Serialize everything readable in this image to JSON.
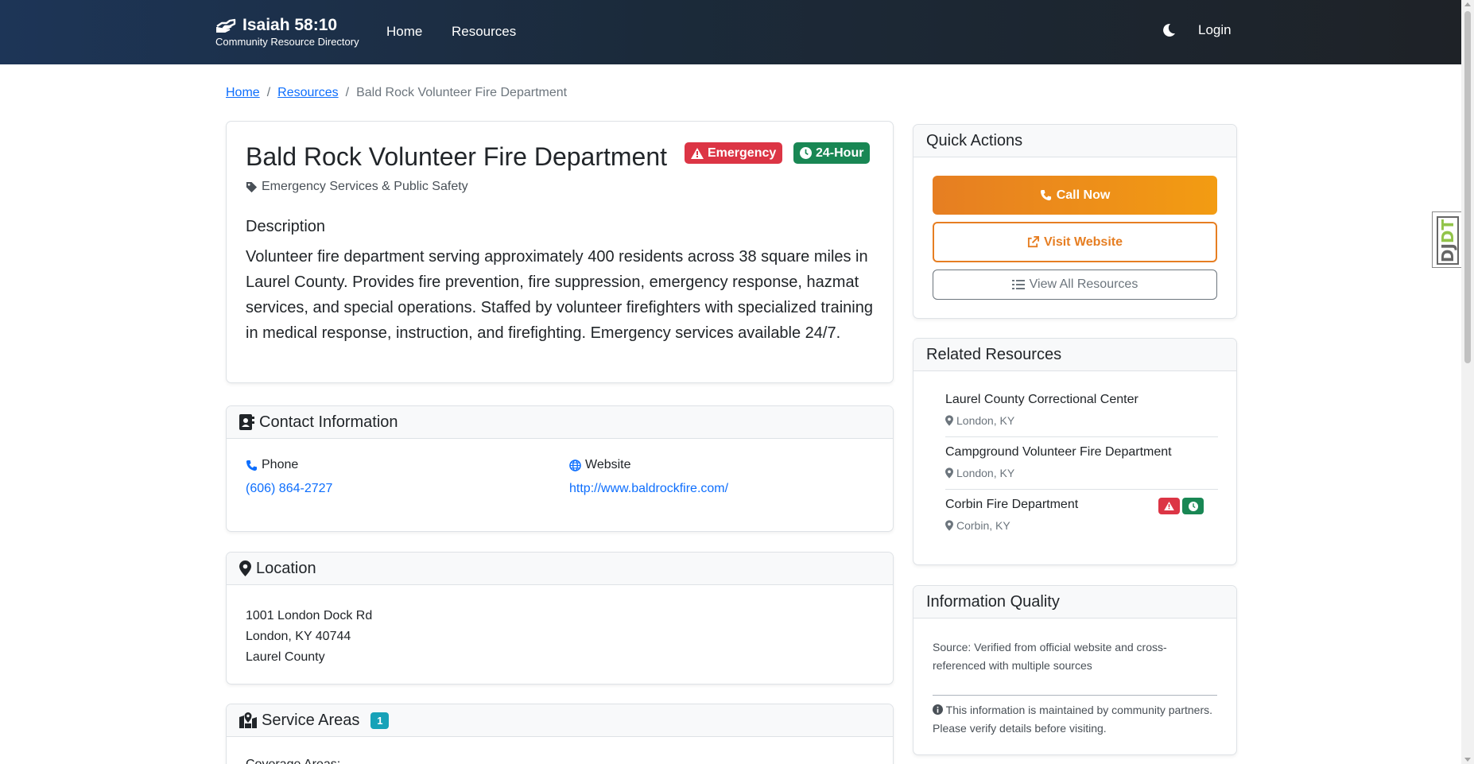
{
  "nav": {
    "brand_title": "Isaiah 58:10",
    "brand_sub": "Community Resource Directory",
    "links": [
      "Home",
      "Resources"
    ],
    "login": "Login"
  },
  "breadcrumb": {
    "home": "Home",
    "resources": "Resources",
    "current": "Bald Rock Volunteer Fire Department"
  },
  "resource": {
    "title": "Bald Rock Volunteer Fire Department",
    "badge_emergency": "Emergency",
    "badge_24hour": "24-Hour",
    "category": "Emergency Services & Public Safety",
    "description_heading": "Description",
    "description": "Volunteer fire department serving approximately 400 residents across 38 square miles in Laurel County. Provides fire prevention, fire suppression, emergency response, hazmat services, and special operations. Staffed by volunteer firefighters with specialized training in medical response, instruction, and firefighting. Emergency services available 24/7."
  },
  "contact": {
    "heading": "Contact Information",
    "phone_label": "Phone",
    "phone": "(606) 864-2727",
    "website_label": "Website",
    "website": "http://www.baldrockfire.com/"
  },
  "location": {
    "heading": "Location",
    "street": "1001 London Dock Rd",
    "city": "London, KY 40744",
    "county": "Laurel County"
  },
  "service_areas": {
    "heading": "Service Areas",
    "count": "1",
    "coverage_label": "Coverage Areas:"
  },
  "quick_actions": {
    "heading": "Quick Actions",
    "call": "Call Now",
    "visit": "Visit Website",
    "view_all": "View All Resources"
  },
  "related": {
    "heading": "Related Resources",
    "items": [
      {
        "name": "Laurel County Correctional Center",
        "location": "London, KY"
      },
      {
        "name": "Campground Volunteer Fire Department",
        "location": "London, KY"
      },
      {
        "name": "Corbin Fire Department",
        "location": "Corbin, KY"
      }
    ]
  },
  "quality": {
    "heading": "Information Quality",
    "source": "Source: Verified from official website and cross-referenced with multiple sources",
    "note": "This information is maintained by community partners. Please verify details before visiting."
  },
  "debug_toolbar": {
    "prefix": "DJ",
    "suffix": "DT"
  },
  "colors": {
    "primary_link": "#0d6efd",
    "emergency": "#dc3545",
    "twentyfour": "#198754",
    "accent_orange": "#e67e22",
    "count_badge": "#17a2b8"
  }
}
